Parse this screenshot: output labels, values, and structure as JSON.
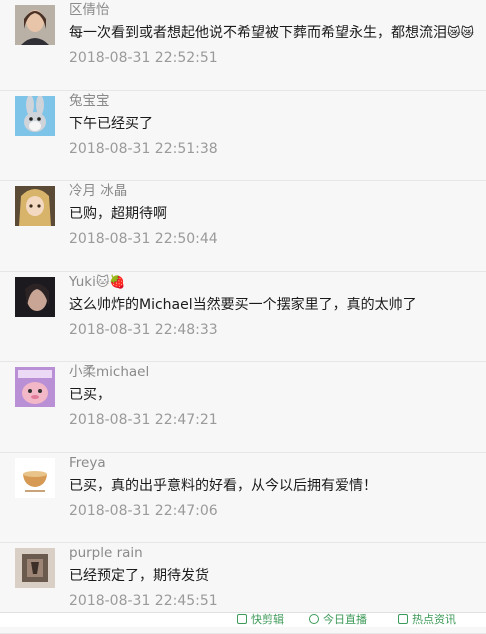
{
  "comments": [
    {
      "name": "区倩怡",
      "text": "每一次看到或者想起他说不希望被下葬而希望永生，都想流泪",
      "emoji": "😿😿",
      "time": "2018-08-31 22:52:51",
      "avatar": "photo-woman"
    },
    {
      "name": "兔宝宝",
      "text": "下午已经买了",
      "emoji": "",
      "time": "2018-08-31 22:51:38",
      "avatar": "bugs-bunny"
    },
    {
      "name": "冷月 冰晶",
      "text": "已购，超期待啊",
      "emoji": "",
      "time": "2018-08-31 22:50:44",
      "avatar": "anime-girl"
    },
    {
      "name": "Yuki",
      "name_emoji": "🐱🍓",
      "text": "这么帅炸的Michael当然要买一个摆家里了，真的太帅了",
      "emoji": "",
      "time": "2018-08-31 22:48:33",
      "avatar": "photo-dark"
    },
    {
      "name": "小柔michael",
      "text": "已买，",
      "emoji": "",
      "time": "2018-08-31 22:47:21",
      "avatar": "cartoon-pink"
    },
    {
      "name": "Freya",
      "text": "已买，真的出乎意料的好看，从今以后拥有爱情！",
      "emoji": "",
      "time": "2018-08-31 22:47:06",
      "avatar": "bowl-logo"
    },
    {
      "name": "purple rain",
      "text": "已经预定了，期待发货",
      "emoji": "",
      "time": "2018-08-31 22:45:51",
      "avatar": "album-cover"
    }
  ],
  "footer": {
    "items": [
      {
        "label": "快剪辑",
        "icon": "scissors-icon"
      },
      {
        "label": "今日直播",
        "icon": "live-icon"
      },
      {
        "label": "热点资讯",
        "icon": "news-icon"
      }
    ]
  }
}
